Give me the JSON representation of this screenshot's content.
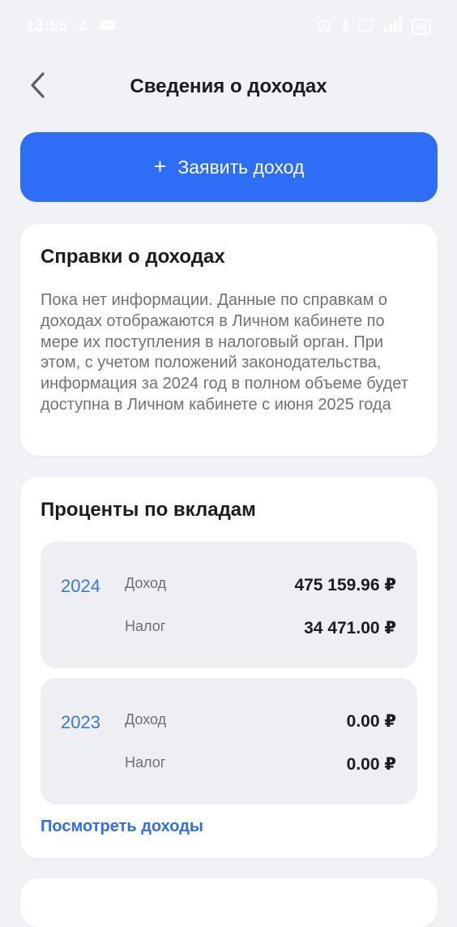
{
  "status_bar": {
    "time": "13:55",
    "battery": "82"
  },
  "header": {
    "title": "Сведения о доходах"
  },
  "primary_action": {
    "plus": "+",
    "label": "Заявить доход"
  },
  "certificates_card": {
    "title": "Справки о доходах",
    "body": "Пока нет информации. Данные по справкам о доходах отображаются в Личном кабинете по мере их поступления в налоговый орган. При этом, с учетом положений законодательства, информация за 2024 год в полном объеме будет доступна в Личном кабинете с июня 2025 года"
  },
  "deposits_card": {
    "title": "Проценты по вкладам",
    "years": [
      {
        "year": "2024",
        "income_label": "Доход",
        "income_value": "475 159.96 ₽",
        "tax_label": "Налог",
        "tax_value": "34 471.00 ₽"
      },
      {
        "year": "2023",
        "income_label": "Доход",
        "income_value": "0.00 ₽",
        "tax_label": "Налог",
        "tax_value": "0.00 ₽"
      }
    ],
    "link": "Посмотреть доходы"
  },
  "icons": {
    "back": "chevron-left-icon"
  },
  "colors": {
    "accent": "#2e6df6",
    "year": "#3c78d8",
    "background": "#f1f2f5"
  }
}
